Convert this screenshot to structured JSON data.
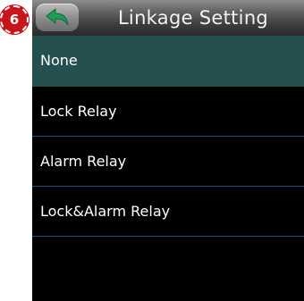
{
  "step_badge": "6",
  "header": {
    "title": "Linkage Setting",
    "back_icon": "back-arrow-icon"
  },
  "colors": {
    "accent_green": "#1f9c5a",
    "selected_row": "#24504f",
    "divider": "#1a4f87",
    "badge_red": "#c8151b"
  },
  "menu": {
    "selected_index": 0,
    "items": [
      {
        "label": "None"
      },
      {
        "label": "Lock Relay"
      },
      {
        "label": "Alarm Relay"
      },
      {
        "label": "Lock&Alarm Relay"
      }
    ]
  }
}
